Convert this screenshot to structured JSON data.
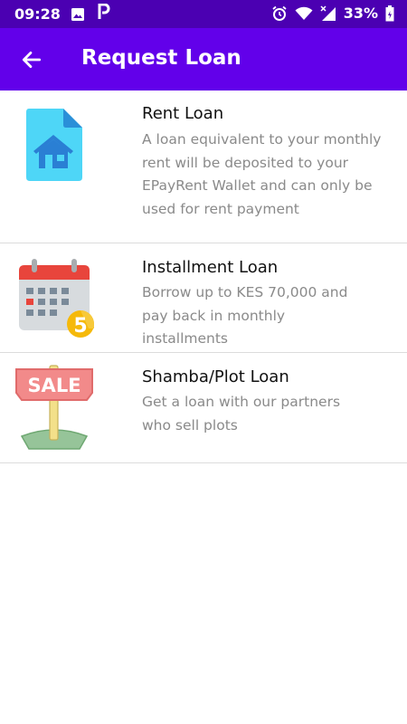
{
  "status_bar": {
    "time": "09:28",
    "battery": "33%",
    "icons": [
      "photo-icon",
      "p-icon",
      "alarm-icon",
      "wifi-icon",
      "signal-icon",
      "battery-icon"
    ]
  },
  "app_bar": {
    "title": "Request Loan",
    "back_icon": "arrow-left-icon"
  },
  "loans": [
    {
      "title": "Rent Loan",
      "description": "A loan equivalent to your monthly rent will be deposited to your EPayRent Wallet and can only be used for rent payment",
      "icon": "house-document-icon"
    },
    {
      "title": "Installment Loan",
      "description": "Borrow up to KES 70,000 and pay back in monthly installments",
      "icon": "calendar-icon",
      "icon_badge": "5"
    },
    {
      "title": "Shamba/Plot Loan",
      "description": "Get a loan with our partners who sell plots",
      "icon": "sale-sign-icon",
      "icon_text": "SALE"
    }
  ],
  "colors": {
    "status_bar": "#4b00b2",
    "app_bar": "#6200ea",
    "title_text": "#111111",
    "description_text": "#8a8a8a"
  }
}
